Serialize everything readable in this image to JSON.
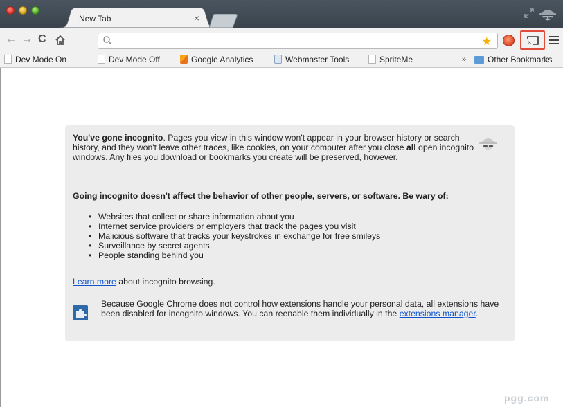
{
  "tab": {
    "title": "New Tab",
    "close": "×"
  },
  "toolbar": {
    "url_value": ""
  },
  "bookmarks": {
    "items": [
      {
        "label": "Dev Mode On"
      },
      {
        "label": "Dev Mode Off"
      },
      {
        "label": "Google Analytics"
      },
      {
        "label": "Webmaster Tools"
      },
      {
        "label": "SpriteMe"
      }
    ],
    "overflow": "»",
    "other": "Other Bookmarks"
  },
  "incognito": {
    "intro_bold": "You've gone incognito",
    "intro_rest_1": ". Pages you view in this window won't appear in your browser history or search history, and they won't leave other traces, like cookies, on your computer after you close ",
    "intro_all": "all",
    "intro_rest_2": " open incognito windows. Any files you download or bookmarks you create will be preserved, however.",
    "heading": "Going incognito doesn't affect the behavior of other people, servers, or software. Be wary of:",
    "bullets": [
      "Websites that collect or share information about you",
      "Internet service providers or employers that track the pages you visit",
      "Malicious software that tracks your keystrokes in exchange for free smileys",
      "Surveillance by secret agents",
      "People standing behind you"
    ],
    "learn_more_link": "Learn more",
    "learn_more_rest": " about incognito browsing.",
    "ext_text": "Because Google Chrome does not control how extensions handle your personal data, all extensions have been disabled for incognito windows. You can reenable them individually in the ",
    "ext_link": "extensions manager",
    "ext_end": "."
  },
  "watermark": "pgg.com"
}
